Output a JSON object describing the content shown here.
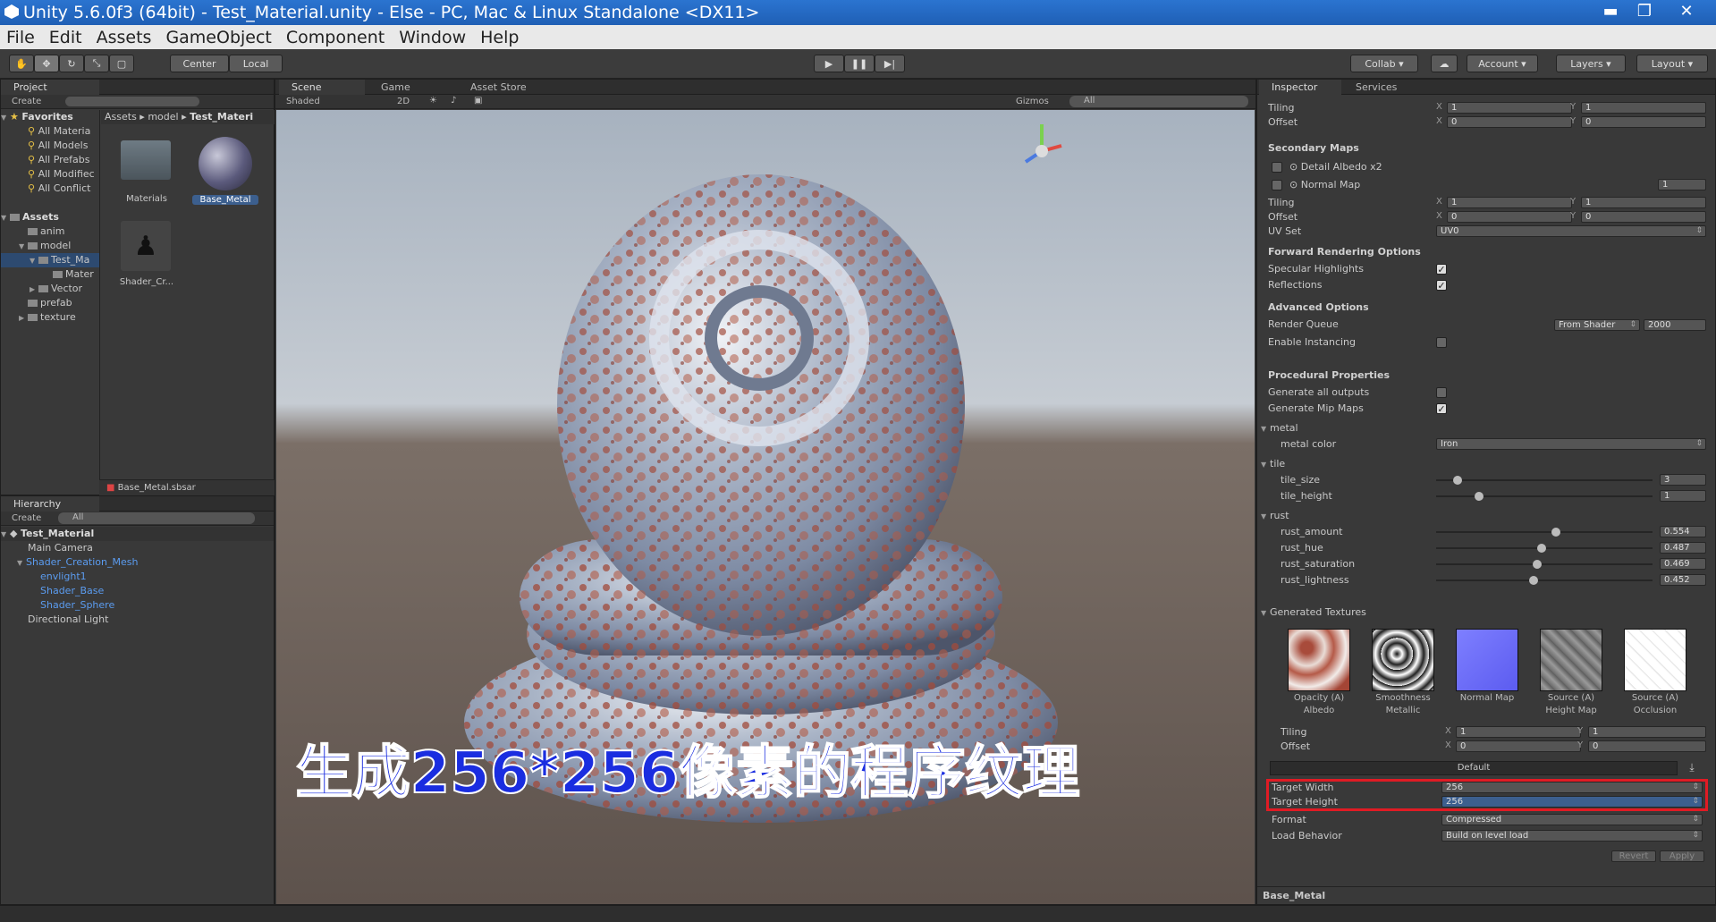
{
  "window": {
    "title": "Unity 5.6.0f3 (64bit) - Test_Material.unity - Else - PC, Mac & Linux Standalone <DX11>",
    "minimize": "▬",
    "maximize": "❐",
    "close": "✕"
  },
  "menu": [
    "File",
    "Edit",
    "Assets",
    "GameObject",
    "Component",
    "Window",
    "Help"
  ],
  "toolbar": {
    "pivot": "Center",
    "space": "Local",
    "collab": "Collab",
    "account": "Account",
    "layers": "Layers",
    "layout": "Layout",
    "play_icon": "play-icon",
    "pause_icon": "pause-icon",
    "step_icon": "step-icon"
  },
  "project": {
    "tab": "Project",
    "create": "Create",
    "breadcrumb": [
      "Assets",
      "model",
      "Test_Materi"
    ],
    "favorites_title": "Favorites",
    "favorites": [
      "All Materia",
      "All Models",
      "All Prefabs",
      "All Modifiec",
      "All Conflict"
    ],
    "assets_title": "Assets",
    "tree": [
      {
        "label": "anim",
        "depth": 1
      },
      {
        "label": "model",
        "depth": 1
      },
      {
        "label": "Test_Ma",
        "depth": 2
      },
      {
        "label": "Mater",
        "depth": 3
      },
      {
        "label": "Vector",
        "depth": 2
      },
      {
        "label": "prefab",
        "depth": 1
      },
      {
        "label": "texture",
        "depth": 1
      }
    ],
    "grid": [
      {
        "label": "Materials",
        "kind": "folder"
      },
      {
        "label": "Base_Metal",
        "kind": "material"
      },
      {
        "label": "Shader_Cr...",
        "kind": "shader"
      }
    ],
    "status_file": "Base_Metal.sbsar"
  },
  "hierarchy": {
    "tab": "Hierarchy",
    "create": "Create",
    "search": "All",
    "scene": "Test_Material",
    "items": [
      {
        "label": "Main Camera",
        "depth": 1,
        "blue": false
      },
      {
        "label": "Shader_Creation_Mesh",
        "depth": 1,
        "blue": true
      },
      {
        "label": "envlight1",
        "depth": 2,
        "blue": true
      },
      {
        "label": "Shader_Base",
        "depth": 2,
        "blue": true
      },
      {
        "label": "Shader_Sphere",
        "depth": 2,
        "blue": true
      },
      {
        "label": "Directional Light",
        "depth": 1,
        "blue": false
      }
    ]
  },
  "scene_view": {
    "tabs": [
      "Scene",
      "Game",
      "Asset Store"
    ],
    "shading": "Shaded",
    "mode2d": "2D",
    "gizmos": "Gizmos",
    "search": "All",
    "subtitle": "生成256*256像素的程序纹理"
  },
  "inspector": {
    "tabs": [
      "Inspector",
      "Services"
    ],
    "top_tiling": {
      "label": "Tiling",
      "x": "1",
      "y": "1"
    },
    "top_offset": {
      "label": "Offset",
      "x": "0",
      "y": "0"
    },
    "secondary_maps": "Secondary Maps",
    "detail_albedo": "Detail Albedo x2",
    "normal_map": "Normal Map",
    "normal_map_value": "1",
    "sec_tiling": {
      "label": "Tiling",
      "x": "1",
      "y": "1"
    },
    "sec_offset": {
      "label": "Offset",
      "x": "0",
      "y": "0"
    },
    "uv_set": {
      "label": "UV Set",
      "value": "UV0"
    },
    "forward_title": "Forward Rendering Options",
    "specular": "Specular Highlights",
    "reflections": "Reflections",
    "advanced_title": "Advanced Options",
    "render_queue": "Render Queue",
    "render_queue_mode": "From Shader",
    "render_queue_value": "2000",
    "instancing": "Enable Instancing",
    "procedural_title": "Procedural Properties",
    "gen_outputs": "Generate all outputs",
    "gen_mips": "Generate Mip Maps",
    "metal_group": "metal",
    "metal_color": "metal color",
    "metal_color_value": "Iron",
    "tile_group": "tile",
    "tile_size": {
      "label": "tile_size",
      "value": "3",
      "pos": 0.1
    },
    "tile_height": {
      "label": "tile_height",
      "value": "1",
      "pos": 0.2
    },
    "rust_group": "rust",
    "rust": [
      {
        "label": "rust_amount",
        "value": "0.554",
        "pos": 0.554
      },
      {
        "label": "rust_hue",
        "value": "0.487",
        "pos": 0.487
      },
      {
        "label": "rust_saturation",
        "value": "0.469",
        "pos": 0.469
      },
      {
        "label": "rust_lightness",
        "value": "0.452",
        "pos": 0.452
      }
    ],
    "generated_title": "Generated Textures",
    "textures": [
      {
        "top": "Opacity (A)",
        "bottom": "Albedo",
        "color": "albedo"
      },
      {
        "top": "Smoothness",
        "bottom": "Metallic",
        "color": "mono"
      },
      {
        "top": "Normal Map",
        "bottom": "",
        "color": "normal"
      },
      {
        "top": "Source (A)",
        "bottom": "Height Map",
        "color": "height"
      },
      {
        "top": "Source (A)",
        "bottom": "Occlusion",
        "color": "occ"
      }
    ],
    "gen_tiling": {
      "label": "Tiling",
      "x": "1",
      "y": "1"
    },
    "gen_offset": {
      "label": "Offset",
      "x": "0",
      "y": "0"
    },
    "platform": "Default",
    "target_width": {
      "label": "Target Width",
      "value": "256"
    },
    "target_height": {
      "label": "Target Height",
      "value": "256"
    },
    "format": {
      "label": "Format",
      "value": "Compressed"
    },
    "load_behavior": {
      "label": "Load Behavior",
      "value": "Build on level load"
    },
    "revert": "Revert",
    "apply": "Apply",
    "footer": "Base_Metal"
  },
  "colors": {
    "highlight": "#e01b24",
    "subtitle_fill": "#1a2de0",
    "accent_blue": "#5b9cf0"
  }
}
